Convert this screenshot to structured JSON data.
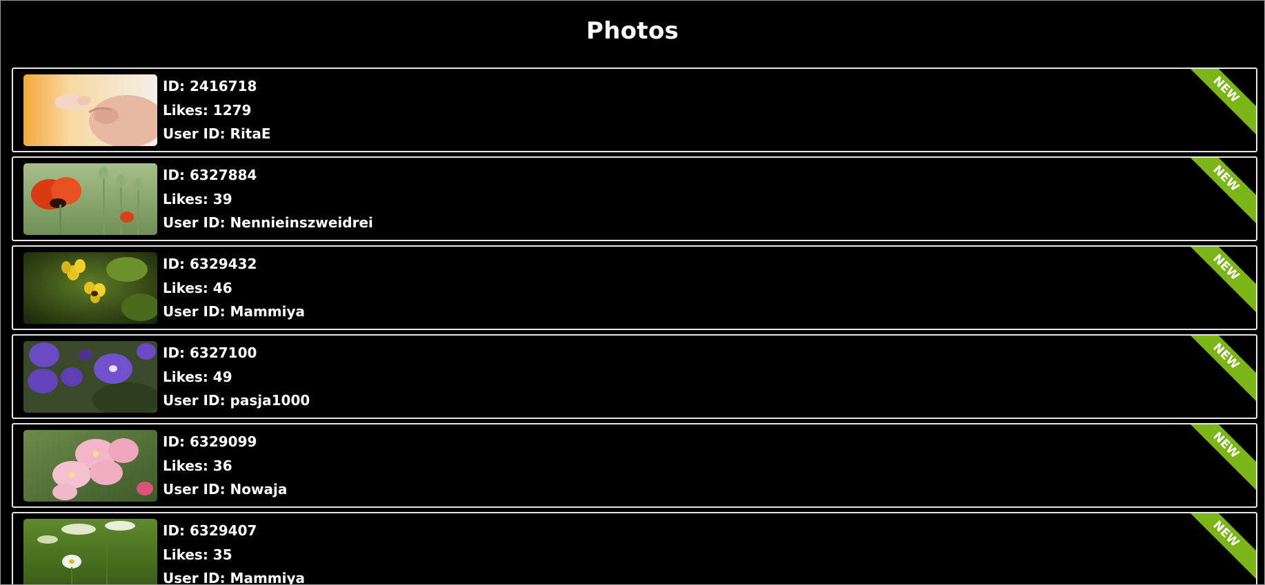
{
  "page": {
    "title": "Photos"
  },
  "labels": {
    "id": "ID: ",
    "likes": "Likes: ",
    "user": "User ID: "
  },
  "ribbon_text": "NEW",
  "colors": {
    "ribbon": "#7cb518",
    "card_border": "#e8e8e8",
    "background": "#000000"
  },
  "photos": [
    {
      "id": "2416718",
      "likes": "1279",
      "user_id": "RitaE",
      "thumbnail": "baby-hand-photo"
    },
    {
      "id": "6327884",
      "likes": "39",
      "user_id": "Nennieinszweidrei",
      "thumbnail": "red-poppy-photo"
    },
    {
      "id": "6329432",
      "likes": "46",
      "user_id": "Mammiya",
      "thumbnail": "yellow-flower-bee-photo"
    },
    {
      "id": "6327100",
      "likes": "49",
      "user_id": "pasja1000",
      "thumbnail": "purple-geranium-photo"
    },
    {
      "id": "6329099",
      "likes": "36",
      "user_id": "Nowaja",
      "thumbnail": "pink-blossom-photo"
    },
    {
      "id": "6329407",
      "likes": "35",
      "user_id": "Mammiya",
      "thumbnail": "daisies-photo"
    }
  ]
}
